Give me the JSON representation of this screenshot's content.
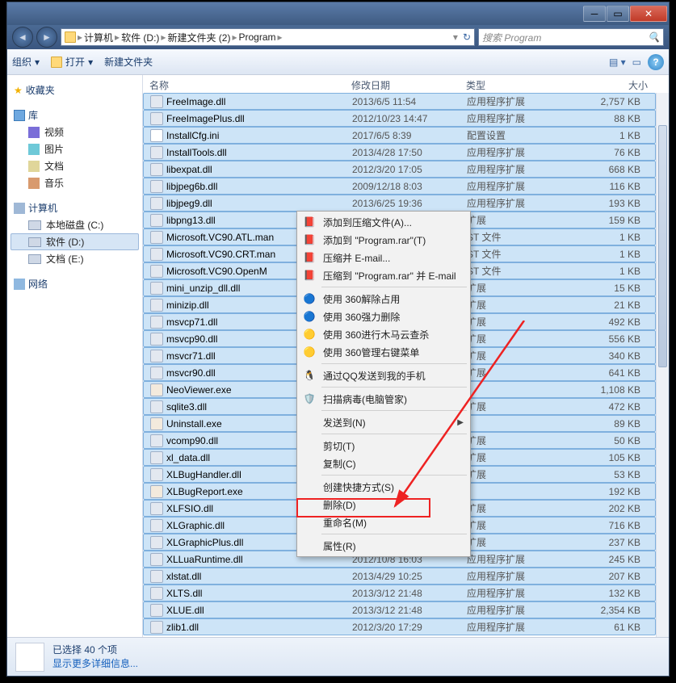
{
  "titlebar": {
    "min": "",
    "max": "",
    "close": ""
  },
  "address": {
    "crumbs": [
      "计算机",
      "软件 (D:)",
      "新建文件夹 (2)",
      "Program"
    ]
  },
  "search": {
    "placeholder": "搜索 Program"
  },
  "toolbar": {
    "organize": "组织",
    "open": "打开",
    "newfolder": "新建文件夹"
  },
  "columns": {
    "name": "名称",
    "date": "修改日期",
    "type": "类型",
    "size": "大小"
  },
  "sidebar": {
    "favorites": "收藏夹",
    "libraries": "库",
    "lib_items": [
      "视频",
      "图片",
      "文档",
      "音乐"
    ],
    "computer": "计算机",
    "drives": [
      "本地磁盘 (C:)",
      "软件 (D:)",
      "文档 (E:)"
    ],
    "network": "网络"
  },
  "files": [
    {
      "n": "FreeImage.dll",
      "d": "2013/6/5 11:54",
      "t": "应用程序扩展",
      "s": "2,757 KB"
    },
    {
      "n": "FreeImagePlus.dll",
      "d": "2012/10/23 14:47",
      "t": "应用程序扩展",
      "s": "88 KB"
    },
    {
      "n": "InstallCfg.ini",
      "d": "2017/6/5 8:39",
      "t": "配置设置",
      "s": "1 KB"
    },
    {
      "n": "InstallTools.dll",
      "d": "2013/4/28 17:50",
      "t": "应用程序扩展",
      "s": "76 KB"
    },
    {
      "n": "libexpat.dll",
      "d": "2012/3/20 17:05",
      "t": "应用程序扩展",
      "s": "668 KB"
    },
    {
      "n": "libjpeg6b.dll",
      "d": "2009/12/18 8:03",
      "t": "应用程序扩展",
      "s": "116 KB"
    },
    {
      "n": "libjpeg9.dll",
      "d": "2013/6/25 19:36",
      "t": "应用程序扩展",
      "s": "193 KB"
    },
    {
      "n": "libpng13.dll",
      "d": "",
      "t": "扩展",
      "s": "159 KB"
    },
    {
      "n": "Microsoft.VC90.ATL.man",
      "d": "",
      "t": "ST 文件",
      "s": "1 KB"
    },
    {
      "n": "Microsoft.VC90.CRT.man",
      "d": "",
      "t": "ST 文件",
      "s": "1 KB"
    },
    {
      "n": "Microsoft.VC90.OpenM",
      "d": "",
      "t": "ST 文件",
      "s": "1 KB"
    },
    {
      "n": "mini_unzip_dll.dll",
      "d": "",
      "t": "扩展",
      "s": "15 KB"
    },
    {
      "n": "minizip.dll",
      "d": "",
      "t": "扩展",
      "s": "21 KB"
    },
    {
      "n": "msvcp71.dll",
      "d": "",
      "t": "扩展",
      "s": "492 KB"
    },
    {
      "n": "msvcp90.dll",
      "d": "",
      "t": "扩展",
      "s": "556 KB"
    },
    {
      "n": "msvcr71.dll",
      "d": "",
      "t": "扩展",
      "s": "340 KB"
    },
    {
      "n": "msvcr90.dll",
      "d": "",
      "t": "扩展",
      "s": "641 KB"
    },
    {
      "n": "NeoViewer.exe",
      "d": "",
      "t": "",
      "s": "1,108 KB"
    },
    {
      "n": "sqlite3.dll",
      "d": "",
      "t": "扩展",
      "s": "472 KB"
    },
    {
      "n": "Uninstall.exe",
      "d": "",
      "t": "",
      "s": "89 KB"
    },
    {
      "n": "vcomp90.dll",
      "d": "",
      "t": "扩展",
      "s": "50 KB"
    },
    {
      "n": "xl_data.dll",
      "d": "",
      "t": "扩展",
      "s": "105 KB"
    },
    {
      "n": "XLBugHandler.dll",
      "d": "",
      "t": "扩展",
      "s": "53 KB"
    },
    {
      "n": "XLBugReport.exe",
      "d": "",
      "t": "",
      "s": "192 KB"
    },
    {
      "n": "XLFSIO.dll",
      "d": "",
      "t": "扩展",
      "s": "202 KB"
    },
    {
      "n": "XLGraphic.dll",
      "d": "",
      "t": "扩展",
      "s": "716 KB"
    },
    {
      "n": "XLGraphicPlus.dll",
      "d": "",
      "t": "扩展",
      "s": "237 KB"
    },
    {
      "n": "XLLuaRuntime.dll",
      "d": "2012/10/8 16:03",
      "t": "应用程序扩展",
      "s": "245 KB"
    },
    {
      "n": "xlstat.dll",
      "d": "2013/4/29 10:25",
      "t": "应用程序扩展",
      "s": "207 KB"
    },
    {
      "n": "XLTS.dll",
      "d": "2013/3/12 21:48",
      "t": "应用程序扩展",
      "s": "132 KB"
    },
    {
      "n": "XLUE.dll",
      "d": "2013/3/12 21:48",
      "t": "应用程序扩展",
      "s": "2,354 KB"
    },
    {
      "n": "zlib1.dll",
      "d": "2012/3/20 17:29",
      "t": "应用程序扩展",
      "s": "61 KB"
    }
  ],
  "context": {
    "items1": [
      {
        "l": "添加到压缩文件(A)...",
        "i": "rar"
      },
      {
        "l": "添加到 \"Program.rar\"(T)",
        "i": "rar"
      },
      {
        "l": "压缩并 E-mail...",
        "i": "rar"
      },
      {
        "l": "压缩到 \"Program.rar\" 并 E-mail",
        "i": "rar"
      }
    ],
    "items2": [
      {
        "l": "使用 360解除占用",
        "i": "360"
      },
      {
        "l": "使用 360强力删除",
        "i": "360"
      },
      {
        "l": "使用 360进行木马云查杀",
        "i": "360y"
      },
      {
        "l": "使用 360管理右键菜单",
        "i": "360y"
      }
    ],
    "items3": [
      {
        "l": "通过QQ发送到我的手机",
        "i": "qq"
      }
    ],
    "items4": [
      {
        "l": "扫描病毒(电脑管家)",
        "i": "gm"
      }
    ],
    "items5": [
      {
        "l": "发送到(N)",
        "sub": true
      }
    ],
    "items6": [
      {
        "l": "剪切(T)"
      },
      {
        "l": "复制(C)"
      }
    ],
    "items7": [
      {
        "l": "创建快捷方式(S)"
      },
      {
        "l": "删除(D)"
      },
      {
        "l": "重命名(M)"
      }
    ],
    "items8": [
      {
        "l": "属性(R)"
      }
    ]
  },
  "status": {
    "line1": "已选择 40 个项",
    "line2": "显示更多详细信息..."
  }
}
